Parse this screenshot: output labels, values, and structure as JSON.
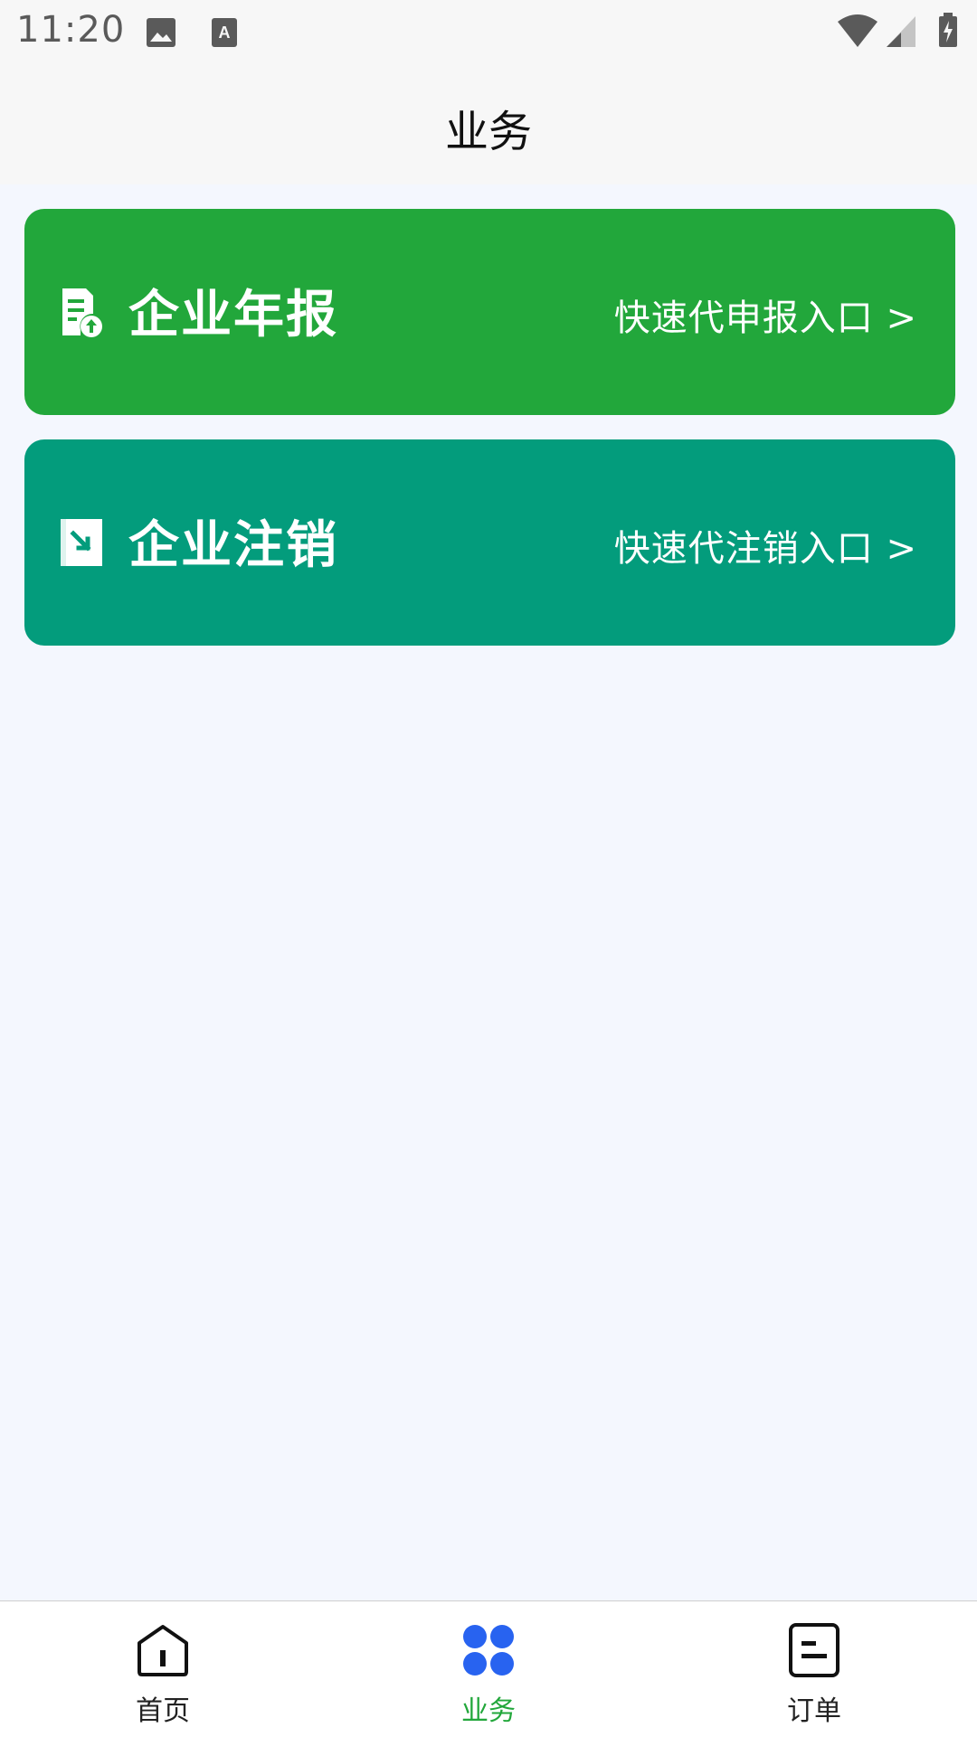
{
  "status_bar": {
    "time": "11:20",
    "icons": [
      "image-icon",
      "text-a-icon",
      "wifi-icon",
      "signal-icon",
      "battery-charging-icon"
    ]
  },
  "header": {
    "title": "业务"
  },
  "cards": [
    {
      "title": "企业年报",
      "link": "快速代申报入口 >",
      "icon": "report-upload-icon",
      "color": "#22a73b"
    },
    {
      "title": "企业注销",
      "link": "快速代注销入口 >",
      "icon": "cancel-doc-icon",
      "color": "#039c7c"
    }
  ],
  "bottom_nav": {
    "items": [
      {
        "label": "首页",
        "icon": "home-icon",
        "active": false
      },
      {
        "label": "业务",
        "icon": "grid-icon",
        "active": true
      },
      {
        "label": "订单",
        "icon": "order-icon",
        "active": false
      }
    ],
    "active_color": "#22a73b",
    "active_icon_color": "#2863f0"
  }
}
